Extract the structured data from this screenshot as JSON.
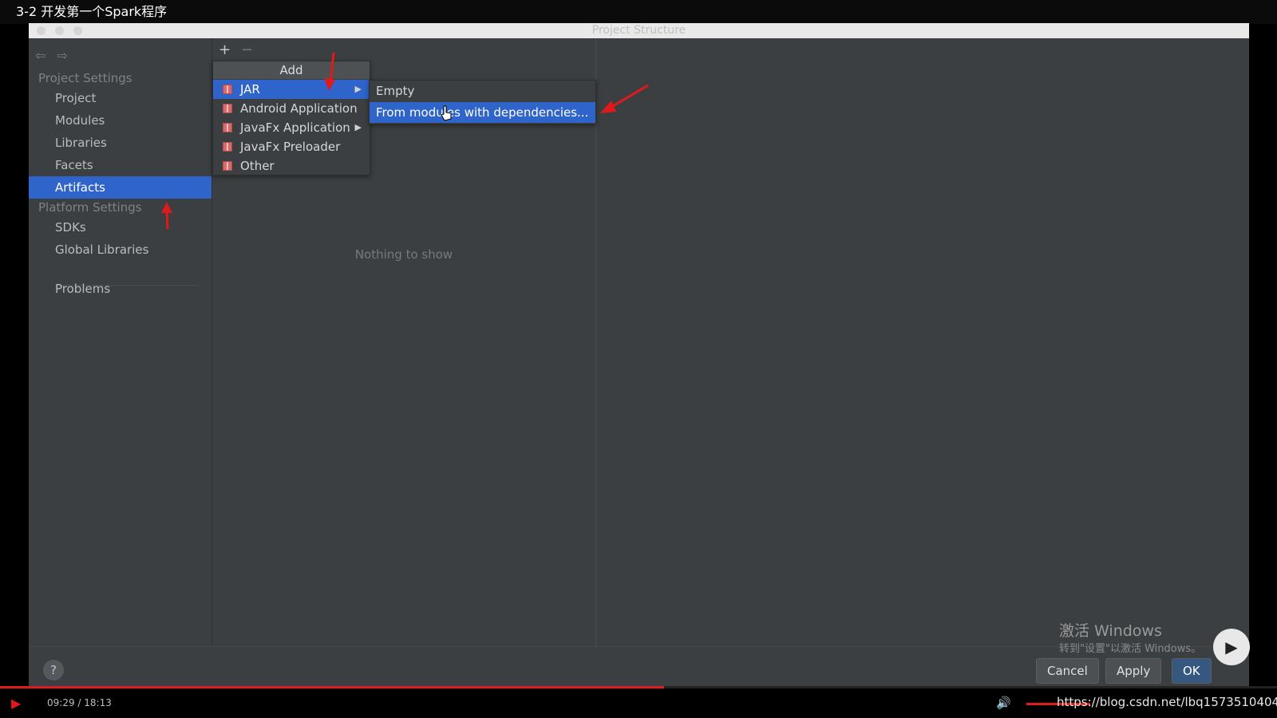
{
  "video": {
    "title": "3-2 开发第一个Spark程序",
    "time": "09:29 / 18:13",
    "progress_fraction": 0.52,
    "watermark_url": "https://blog.csdn.net/lbq1573510404"
  },
  "window": {
    "title": "Project Structure"
  },
  "sidebar": {
    "project_settings_label": "Project Settings",
    "platform_settings_label": "Platform Settings",
    "items": [
      {
        "label": "Project"
      },
      {
        "label": "Modules"
      },
      {
        "label": "Libraries"
      },
      {
        "label": "Facets"
      },
      {
        "label": "Artifacts"
      }
    ],
    "platform_items": [
      {
        "label": "SDKs"
      },
      {
        "label": "Global Libraries"
      }
    ],
    "problems_label": "Problems",
    "selected": "Artifacts"
  },
  "toolbar": {
    "add_symbol": "+",
    "remove_symbol": "−",
    "back_icon": "back-arrow-icon",
    "forward_icon": "forward-arrow-icon"
  },
  "panel": {
    "empty_text": "Nothing to show"
  },
  "add_menu": {
    "header": "Add",
    "items": [
      {
        "label": "JAR",
        "has_submenu": true
      },
      {
        "label": "Android Application",
        "has_submenu": false
      },
      {
        "label": "JavaFx Application",
        "has_submenu": true
      },
      {
        "label": "JavaFx Preloader",
        "has_submenu": false
      },
      {
        "label": "Other",
        "has_submenu": false
      }
    ],
    "submenu_arrow": "▶"
  },
  "jar_submenu": {
    "items": [
      {
        "label": "Empty"
      },
      {
        "label": "From modules with dependencies..."
      }
    ]
  },
  "buttons": {
    "help": "?",
    "cancel": "Cancel",
    "apply": "Apply",
    "ok": "OK"
  },
  "activation": {
    "line1": "激活 Windows",
    "line2": "转到\"设置\"以激活 Windows。"
  },
  "colors": {
    "selection": "#2f65ca",
    "annotation_red": "#e01a1a",
    "ide_background": "#3c3f41"
  }
}
